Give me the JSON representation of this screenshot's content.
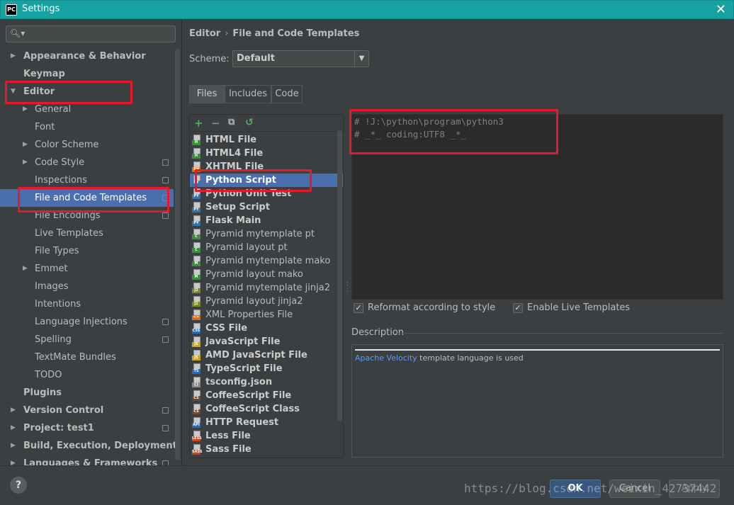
{
  "window": {
    "app_icon_text": "PC",
    "title": "Settings",
    "close_glyph": "✕"
  },
  "search": {
    "placeholder": "",
    "icon": "search-icon"
  },
  "sidebar": {
    "items": [
      {
        "label": "Appearance & Behavior",
        "arrow": "▶",
        "bold": true
      },
      {
        "label": "Keymap",
        "bold": true
      },
      {
        "label": "Editor",
        "arrow": "▼",
        "bold": true
      },
      {
        "label": "General",
        "arrow": "▶"
      },
      {
        "label": "Font"
      },
      {
        "label": "Color Scheme",
        "arrow": "▶"
      },
      {
        "label": "Code Style",
        "arrow": "▶",
        "cfg": true
      },
      {
        "label": "Inspections",
        "cfg": true
      },
      {
        "label": "File and Code Templates",
        "cfg": true,
        "selected": true
      },
      {
        "label": "File Encodings",
        "cfg": true
      },
      {
        "label": "Live Templates"
      },
      {
        "label": "File Types"
      },
      {
        "label": "Emmet",
        "arrow": "▶"
      },
      {
        "label": "Images"
      },
      {
        "label": "Intentions"
      },
      {
        "label": "Language Injections",
        "cfg": true
      },
      {
        "label": "Spelling",
        "cfg": true
      },
      {
        "label": "TextMate Bundles"
      },
      {
        "label": "TODO"
      },
      {
        "label": "Plugins",
        "bold": true
      },
      {
        "label": "Version Control",
        "arrow": "▶",
        "bold": true,
        "cfg": true
      },
      {
        "label": "Project: test1",
        "arrow": "▶",
        "bold": true,
        "cfg": true
      },
      {
        "label": "Build, Execution, Deployment",
        "arrow": "▶",
        "bold": true
      },
      {
        "label": "Languages & Frameworks",
        "arrow": "▶",
        "bold": true,
        "cfg": true
      }
    ]
  },
  "breadcrumb": {
    "parent": "Editor",
    "separator": "›",
    "current": "File and Code Templates"
  },
  "scheme": {
    "label": "Scheme:",
    "value": "Default",
    "dropdown_glyph": "▼"
  },
  "tabs": [
    {
      "label": "Files",
      "active": true
    },
    {
      "label": "Includes"
    },
    {
      "label": "Code"
    }
  ],
  "toolbar": {
    "add": "+",
    "remove": "−",
    "copy": "⧉",
    "reset": "↺"
  },
  "templates": [
    {
      "name": "HTML File",
      "bold": true,
      "tag": "H",
      "color": "#3d8f3d"
    },
    {
      "name": "HTML4 File",
      "bold": true,
      "tag": "H",
      "color": "#3d8f3d"
    },
    {
      "name": "XHTML File",
      "bold": true,
      "tag": "XH",
      "color": "#d26d1e"
    },
    {
      "name": "Python Script",
      "bold": true,
      "tag": "PY",
      "color": "#3572a5",
      "selected": true
    },
    {
      "name": "Python Unit Test",
      "bold": true,
      "tag": "PY",
      "color": "#3572a5"
    },
    {
      "name": "Setup Script",
      "bold": true,
      "tag": "PY",
      "color": "#3572a5"
    },
    {
      "name": "Flask Main",
      "bold": true,
      "tag": "PY",
      "color": "#3572a5"
    },
    {
      "name": "Pyramid mytemplate pt",
      "tag": "C",
      "color": "#3d8f3d"
    },
    {
      "name": "Pyramid layout pt",
      "tag": "C",
      "color": "#3d8f3d"
    },
    {
      "name": "Pyramid mytemplate mako",
      "tag": "M",
      "color": "#3d8f3d"
    },
    {
      "name": "Pyramid layout mako",
      "tag": "M",
      "color": "#3d8f3d"
    },
    {
      "name": "Pyramid mytemplate jinja2",
      "tag": "J2",
      "color": "#7a8a2a"
    },
    {
      "name": "Pyramid layout jinja2",
      "tag": "J2",
      "color": "#7a8a2a"
    },
    {
      "name": "XML Properties File",
      "tag": "<>",
      "color": "#d26d1e"
    },
    {
      "name": "CSS File",
      "bold": true,
      "tag": "CSS",
      "color": "#2a6bb5"
    },
    {
      "name": "JavaScript File",
      "bold": true,
      "tag": "JS",
      "color": "#c9a71e"
    },
    {
      "name": "AMD JavaScript File",
      "bold": true,
      "tag": "JS",
      "color": "#c9a71e"
    },
    {
      "name": "TypeScript File",
      "bold": true,
      "tag": "TS",
      "color": "#2a6bb5"
    },
    {
      "name": "tsconfig.json",
      "bold": true,
      "tag": "{}",
      "color": "#888888"
    },
    {
      "name": "CoffeeScript File",
      "bold": true,
      "tag": "CS",
      "color": "#6b4a2b"
    },
    {
      "name": "CoffeeScript Class",
      "bold": true,
      "tag": "CS",
      "color": "#6b4a2b"
    },
    {
      "name": "HTTP Request",
      "bold": true,
      "tag": "API",
      "color": "#2a6bb5"
    },
    {
      "name": "Less File",
      "bold": true,
      "tag": "LESS",
      "color": "#c6461d"
    },
    {
      "name": "Sass File",
      "bold": true,
      "tag": "SASS",
      "color": "#c6461d"
    }
  ],
  "editor": {
    "lines": [
      "# !J:\\python\\program\\python3",
      "# _*_ coding:UTF8 _*_"
    ]
  },
  "options": {
    "reformat": {
      "label": "Reformat according to style",
      "checked": true
    },
    "live_templates": {
      "label": "Enable Live Templates",
      "checked": true
    }
  },
  "description": {
    "label": "Description",
    "link_text": "Apache Velocity",
    "text": " template language is used"
  },
  "buttons": {
    "help": "?",
    "ok": "OK",
    "cancel": "Cancel",
    "apply": "Apply"
  },
  "watermark": "https://blog.csdn.net/weixin_42737442",
  "colors": {
    "selection": "#4b6eaf",
    "annotation": "#e8192c",
    "titlebar": "#17a2a2"
  }
}
